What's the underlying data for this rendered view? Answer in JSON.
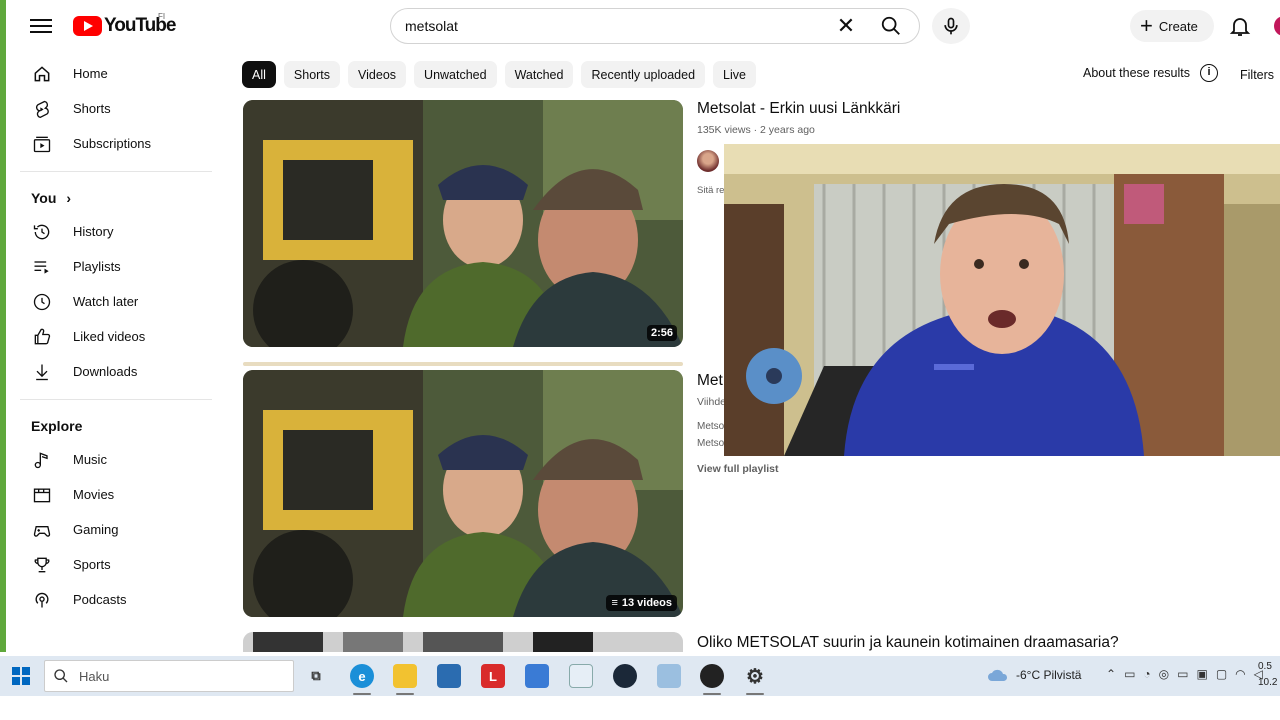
{
  "header": {
    "logo_text": "YouTube",
    "country_code": "FI",
    "search_value": "metsolat",
    "create_label": "Create"
  },
  "sidebar": {
    "main": [
      {
        "label": "Home",
        "icon": "home-icon"
      },
      {
        "label": "Shorts",
        "icon": "shorts-icon"
      },
      {
        "label": "Subscriptions",
        "icon": "subscriptions-icon"
      }
    ],
    "you_heading": "You",
    "you": [
      {
        "label": "History",
        "icon": "history-icon"
      },
      {
        "label": "Playlists",
        "icon": "playlists-icon"
      },
      {
        "label": "Watch later",
        "icon": "watch-later-icon"
      },
      {
        "label": "Liked videos",
        "icon": "liked-icon"
      },
      {
        "label": "Downloads",
        "icon": "download-icon"
      }
    ],
    "explore_heading": "Explore",
    "explore": [
      {
        "label": "Music",
        "icon": "music-icon"
      },
      {
        "label": "Movies",
        "icon": "movies-icon"
      },
      {
        "label": "Gaming",
        "icon": "gaming-icon"
      },
      {
        "label": "Sports",
        "icon": "sports-icon"
      },
      {
        "label": "Podcasts",
        "icon": "podcasts-icon"
      }
    ]
  },
  "chips": [
    "All",
    "Shorts",
    "Videos",
    "Unwatched",
    "Watched",
    "Recently uploaded",
    "Live"
  ],
  "about_results": "About these results",
  "filters_label": "Filters",
  "results": [
    {
      "title": "Metsolat - Erkin uusi Länkkäri",
      "meta": "135K views · 2 years ago",
      "desc_partial": "Sitä re",
      "duration": "2:56"
    },
    {
      "title_partial": "Met",
      "sub_partial": "Viihde",
      "line1_partial": "Metso",
      "line2_partial": "Metso",
      "view_full": "View full playlist",
      "badge": "13 videos"
    },
    {
      "title": "Oliko METSOLAT suurin ja kaunein kotimainen draamasaria?"
    }
  ],
  "taskbar": {
    "search_placeholder": "Haku",
    "weather": "-6°C  Pilvistä",
    "clock_line1": "0.5",
    "clock_line2": "10.2"
  },
  "colors": {
    "brand_red": "#ff0000",
    "chip_active": "#0f0f0f",
    "taskbar_bg": "#dfe8f2"
  }
}
